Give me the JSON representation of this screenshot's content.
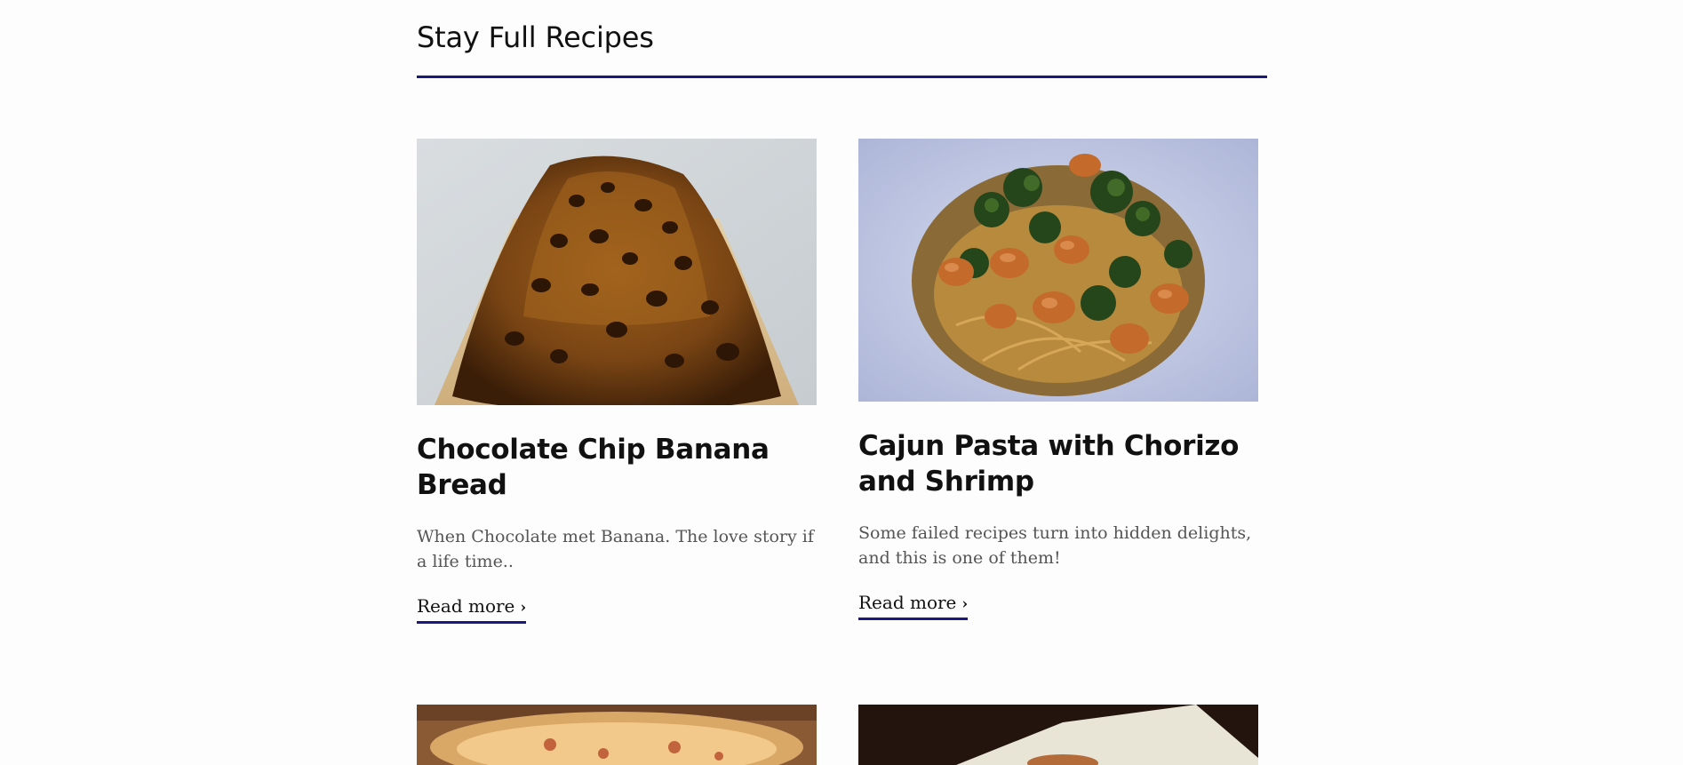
{
  "section": {
    "title": "Stay Full Recipes",
    "accent_color": "#1a1a7e"
  },
  "recipes": [
    {
      "title": "Chocolate Chip Banana Bread",
      "description": "When Chocolate met Banana. The love story if a life time..",
      "link_label": "Read more",
      "link_icon": "chevron-right-icon"
    },
    {
      "title": "Cajun Pasta with Chorizo and Shrimp",
      "description": "Some failed recipes turn into hidden delights, and this is one of them!",
      "link_label": "Read more",
      "link_icon": "chevron-right-icon"
    }
  ]
}
